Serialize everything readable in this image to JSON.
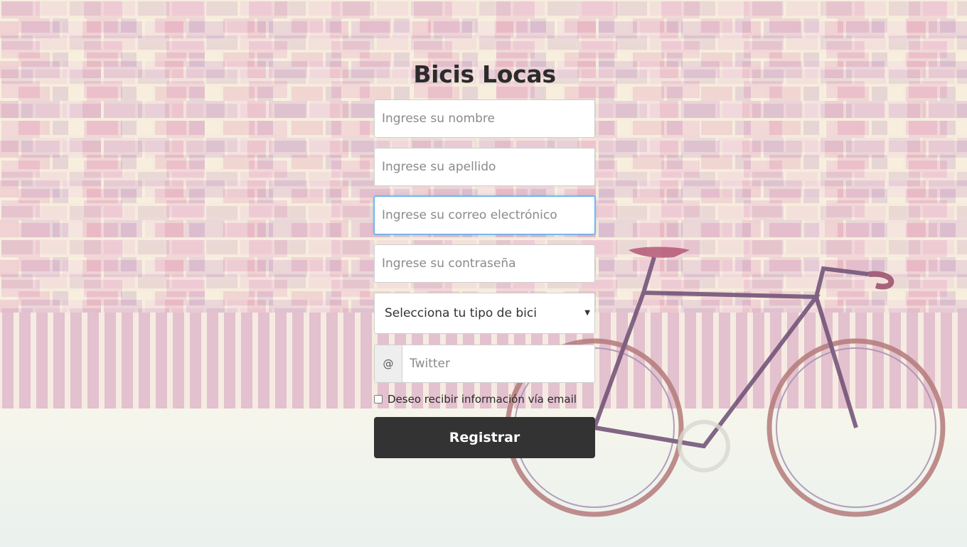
{
  "title": "Bicis Locas",
  "form": {
    "name_placeholder": "Ingrese su nombre",
    "lastname_placeholder": "Ingrese su apellido",
    "email_placeholder": "Ingrese su correo electrónico",
    "password_placeholder": "Ingrese su contraseña",
    "bike_type_selected": "Selecciona tu tipo de bici",
    "twitter_addon": "@",
    "twitter_placeholder": "Twitter",
    "newsletter_label": "Deseo recibir información vía email",
    "newsletter_checked": false,
    "submit_label": "Registrar"
  },
  "icons": {
    "select_arrow": "dropdown-arrow-icon"
  },
  "colors": {
    "button_bg": "#333333",
    "button_text": "#ffffff",
    "focus_border": "#66afe9",
    "title_text": "#2b2b2b"
  }
}
